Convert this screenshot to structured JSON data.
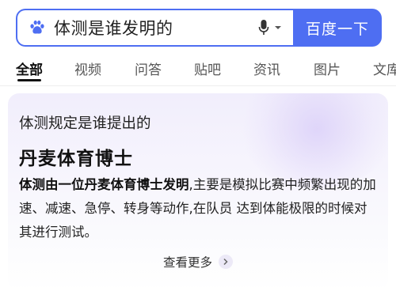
{
  "search": {
    "query": "体测是谁发明的",
    "button_label": "百度一下"
  },
  "tabs": [
    {
      "label": "全部",
      "active": true
    },
    {
      "label": "视频",
      "active": false
    },
    {
      "label": "问答",
      "active": false
    },
    {
      "label": "贴吧",
      "active": false
    },
    {
      "label": "资讯",
      "active": false
    },
    {
      "label": "图片",
      "active": false
    },
    {
      "label": "文库",
      "active": false
    }
  ],
  "card": {
    "question": "体测规定是谁提出的",
    "answer": "丹麦体育博士",
    "desc_highlight": "体测由一位丹麦体育博士发明",
    "desc_rest": ",主要是模拟比赛中频繁出现的加速、减速、急停、转身等动作,在队员 达到体能极限的时候对其进行测试。",
    "see_more": "查看更多"
  },
  "colors": {
    "accent": "#4e6ef2",
    "card_tint": "#f1eefc"
  },
  "icons": [
    "baidu-paw-icon",
    "microphone-icon",
    "caret-down-icon",
    "chevron-right-icon"
  ]
}
